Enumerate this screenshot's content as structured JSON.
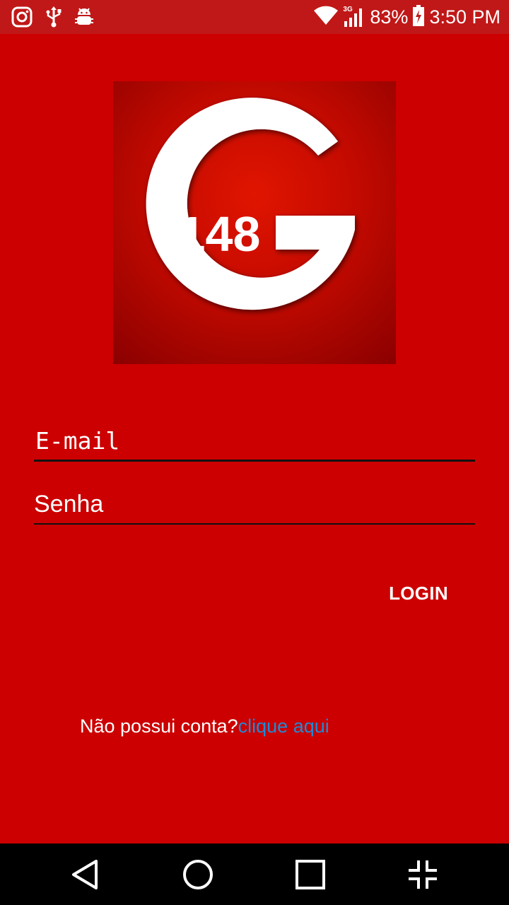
{
  "status_bar": {
    "battery": "83%",
    "time": "3:50 PM",
    "network": "3G",
    "left_icons": [
      "instagram-icon",
      "usb-icon",
      "android-debug-icon"
    ],
    "right_icons": [
      "wifi-icon",
      "signal-icon",
      "battery-charging-icon"
    ]
  },
  "logo": {
    "letter": "G",
    "number": "148"
  },
  "form": {
    "email_placeholder": "E-mail",
    "password_placeholder": "Senha",
    "login_label": "LOGIN"
  },
  "signup": {
    "prompt": "Não possui conta?",
    "link_label": "clique aqui"
  },
  "nav_bar": {
    "buttons": [
      "back-icon",
      "home-icon",
      "recents-icon",
      "fullscreen-exit-icon"
    ]
  },
  "colors": {
    "background": "#cc0000",
    "status_bar": "#c01818",
    "link": "#1f8ad6",
    "nav_bar": "#000000"
  }
}
